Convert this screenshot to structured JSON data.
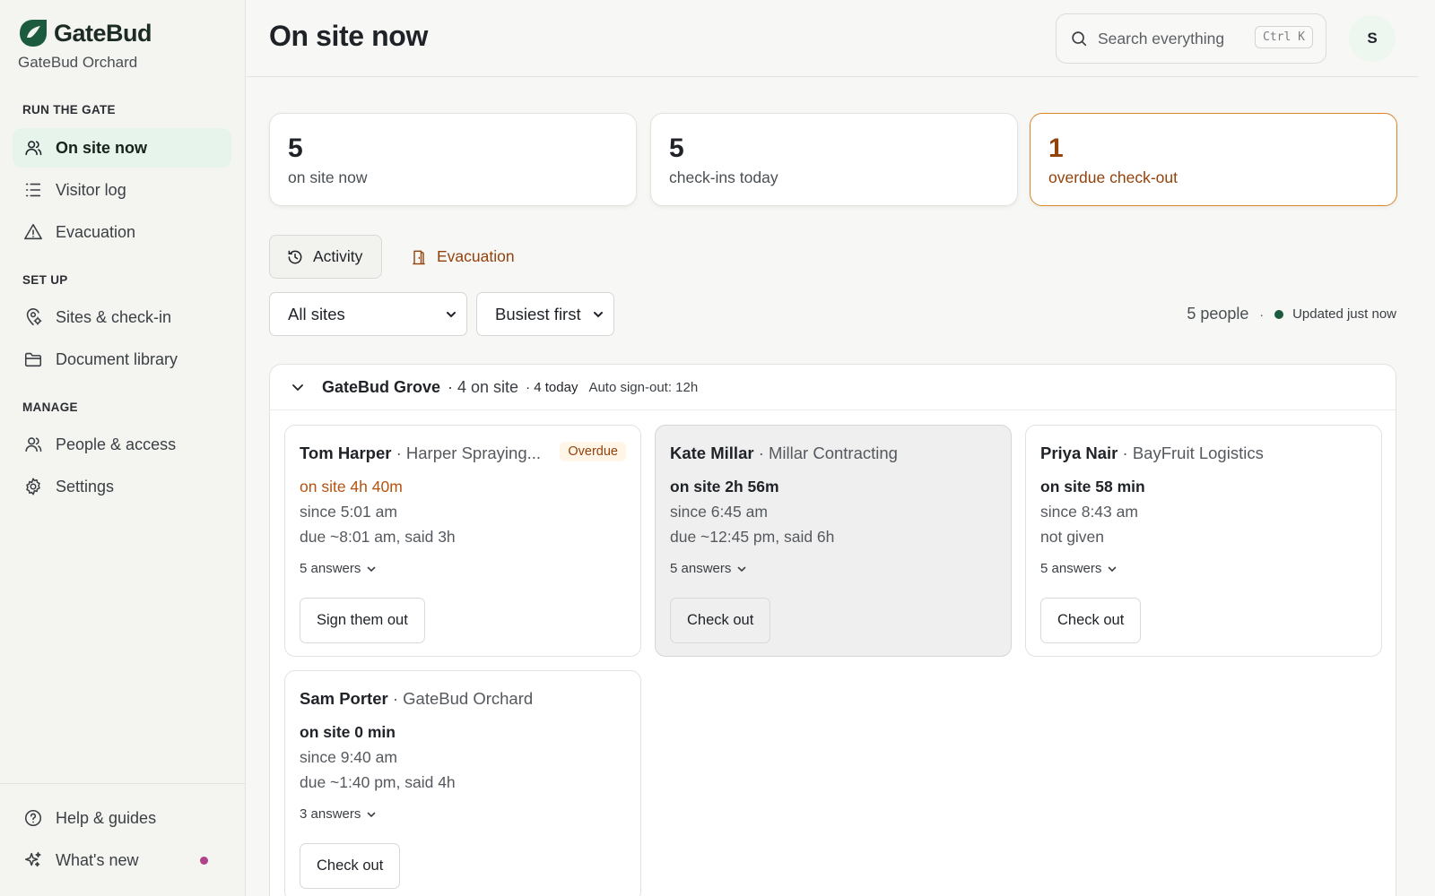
{
  "brand": {
    "name": "GateBud",
    "org": "GateBud Orchard"
  },
  "sidebar": {
    "sections": [
      {
        "title": "RUN THE GATE"
      },
      {
        "title": "SET UP"
      },
      {
        "title": "MANAGE"
      }
    ],
    "items": [
      {
        "label": "On site now",
        "icon": "people-icon",
        "active": true
      },
      {
        "label": "Visitor log",
        "icon": "list-icon"
      },
      {
        "label": "Evacuation",
        "icon": "warning-icon"
      },
      {
        "label": "Sites & check-in",
        "icon": "location-gear-icon"
      },
      {
        "label": "Document library",
        "icon": "folder-icon"
      },
      {
        "label": "People & access",
        "icon": "people-icon"
      },
      {
        "label": "Settings",
        "icon": "gear-icon"
      }
    ],
    "bottom": [
      {
        "label": "Help & guides",
        "icon": "help-icon"
      },
      {
        "label": "What's new",
        "icon": "sparkle-icon",
        "has_dot": true
      }
    ]
  },
  "header": {
    "title": "On site now",
    "search_placeholder": "Search everything",
    "search_shortcut": "Ctrl K",
    "avatar_initial": "S"
  },
  "stats": [
    {
      "value": "5",
      "label": "on site now"
    },
    {
      "value": "5",
      "label": "check-ins today"
    },
    {
      "value": "1",
      "label": "overdue check-out",
      "warn": true
    }
  ],
  "tabs": [
    {
      "label": "Activity",
      "icon": "history-icon"
    },
    {
      "label": "Evacuation",
      "icon": "exit-door-icon"
    }
  ],
  "filters": {
    "site": "All sites",
    "sort": "Busiest first"
  },
  "summary": {
    "count": "5 people",
    "separator": "·",
    "updated": "Updated just now"
  },
  "group": {
    "name": "GateBud Grove",
    "on_site": "· 4 on site",
    "today": "· 4 today",
    "auto_signout": "Auto sign-out: 12h",
    "visitors": [
      {
        "name": "Tom Harper",
        "company": "· Harper Spraying...",
        "badge": "Overdue",
        "duration": "on site 4h 40m",
        "since": "since 5:01 am",
        "due": "due ~8:01 am, said 3h",
        "answers": "5 answers",
        "action": "Sign them out",
        "overdue": true
      },
      {
        "name": "Kate Millar",
        "company": "· Millar Contracting",
        "duration": "on site 2h 56m",
        "since": "since 6:45 am",
        "due": "due ~12:45 pm, said 6h",
        "answers": "5 answers",
        "action": "Check out"
      },
      {
        "name": "Priya Nair",
        "company": "· BayFruit Logistics",
        "duration": "on site 58 min",
        "since": "since 8:43 am",
        "due": "not given",
        "answers": "5 answers",
        "action": "Check out"
      },
      {
        "name": "Sam Porter",
        "company": "· GateBud Orchard",
        "duration": "on site 0 min",
        "since": "since 9:40 am",
        "due": "due ~1:40 pm, said 4h",
        "answers": "3 answers",
        "action": "Check out"
      }
    ]
  },
  "colors": {
    "brand": "#1c5b3e",
    "active_nav": "#e6f4ec",
    "warn_text": "#94420c",
    "warn_border": "#d9862f",
    "new_dot": "#b0428a"
  }
}
